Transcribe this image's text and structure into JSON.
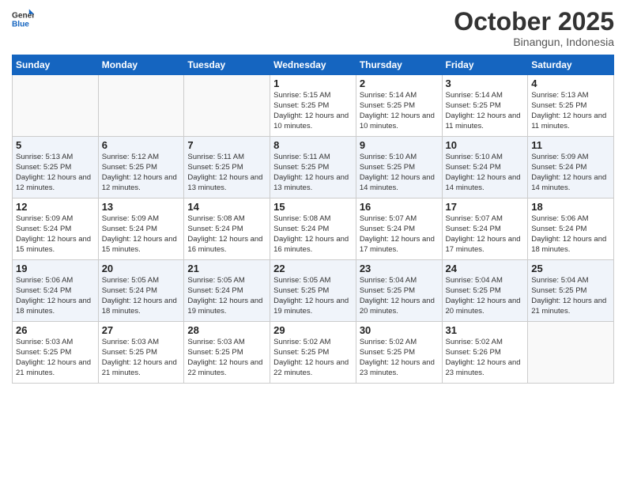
{
  "header": {
    "logo_general": "General",
    "logo_blue": "Blue",
    "month": "October 2025",
    "location": "Binangun, Indonesia"
  },
  "days_of_week": [
    "Sunday",
    "Monday",
    "Tuesday",
    "Wednesday",
    "Thursday",
    "Friday",
    "Saturday"
  ],
  "weeks": [
    [
      {
        "day": "",
        "info": ""
      },
      {
        "day": "",
        "info": ""
      },
      {
        "day": "",
        "info": ""
      },
      {
        "day": "1",
        "info": "Sunrise: 5:15 AM\nSunset: 5:25 PM\nDaylight: 12 hours\nand 10 minutes."
      },
      {
        "day": "2",
        "info": "Sunrise: 5:14 AM\nSunset: 5:25 PM\nDaylight: 12 hours\nand 10 minutes."
      },
      {
        "day": "3",
        "info": "Sunrise: 5:14 AM\nSunset: 5:25 PM\nDaylight: 12 hours\nand 11 minutes."
      },
      {
        "day": "4",
        "info": "Sunrise: 5:13 AM\nSunset: 5:25 PM\nDaylight: 12 hours\nand 11 minutes."
      }
    ],
    [
      {
        "day": "5",
        "info": "Sunrise: 5:13 AM\nSunset: 5:25 PM\nDaylight: 12 hours\nand 12 minutes."
      },
      {
        "day": "6",
        "info": "Sunrise: 5:12 AM\nSunset: 5:25 PM\nDaylight: 12 hours\nand 12 minutes."
      },
      {
        "day": "7",
        "info": "Sunrise: 5:11 AM\nSunset: 5:25 PM\nDaylight: 12 hours\nand 13 minutes."
      },
      {
        "day": "8",
        "info": "Sunrise: 5:11 AM\nSunset: 5:25 PM\nDaylight: 12 hours\nand 13 minutes."
      },
      {
        "day": "9",
        "info": "Sunrise: 5:10 AM\nSunset: 5:25 PM\nDaylight: 12 hours\nand 14 minutes."
      },
      {
        "day": "10",
        "info": "Sunrise: 5:10 AM\nSunset: 5:24 PM\nDaylight: 12 hours\nand 14 minutes."
      },
      {
        "day": "11",
        "info": "Sunrise: 5:09 AM\nSunset: 5:24 PM\nDaylight: 12 hours\nand 14 minutes."
      }
    ],
    [
      {
        "day": "12",
        "info": "Sunrise: 5:09 AM\nSunset: 5:24 PM\nDaylight: 12 hours\nand 15 minutes."
      },
      {
        "day": "13",
        "info": "Sunrise: 5:09 AM\nSunset: 5:24 PM\nDaylight: 12 hours\nand 15 minutes."
      },
      {
        "day": "14",
        "info": "Sunrise: 5:08 AM\nSunset: 5:24 PM\nDaylight: 12 hours\nand 16 minutes."
      },
      {
        "day": "15",
        "info": "Sunrise: 5:08 AM\nSunset: 5:24 PM\nDaylight: 12 hours\nand 16 minutes."
      },
      {
        "day": "16",
        "info": "Sunrise: 5:07 AM\nSunset: 5:24 PM\nDaylight: 12 hours\nand 17 minutes."
      },
      {
        "day": "17",
        "info": "Sunrise: 5:07 AM\nSunset: 5:24 PM\nDaylight: 12 hours\nand 17 minutes."
      },
      {
        "day": "18",
        "info": "Sunrise: 5:06 AM\nSunset: 5:24 PM\nDaylight: 12 hours\nand 18 minutes."
      }
    ],
    [
      {
        "day": "19",
        "info": "Sunrise: 5:06 AM\nSunset: 5:24 PM\nDaylight: 12 hours\nand 18 minutes."
      },
      {
        "day": "20",
        "info": "Sunrise: 5:05 AM\nSunset: 5:24 PM\nDaylight: 12 hours\nand 18 minutes."
      },
      {
        "day": "21",
        "info": "Sunrise: 5:05 AM\nSunset: 5:24 PM\nDaylight: 12 hours\nand 19 minutes."
      },
      {
        "day": "22",
        "info": "Sunrise: 5:05 AM\nSunset: 5:25 PM\nDaylight: 12 hours\nand 19 minutes."
      },
      {
        "day": "23",
        "info": "Sunrise: 5:04 AM\nSunset: 5:25 PM\nDaylight: 12 hours\nand 20 minutes."
      },
      {
        "day": "24",
        "info": "Sunrise: 5:04 AM\nSunset: 5:25 PM\nDaylight: 12 hours\nand 20 minutes."
      },
      {
        "day": "25",
        "info": "Sunrise: 5:04 AM\nSunset: 5:25 PM\nDaylight: 12 hours\nand 21 minutes."
      }
    ],
    [
      {
        "day": "26",
        "info": "Sunrise: 5:03 AM\nSunset: 5:25 PM\nDaylight: 12 hours\nand 21 minutes."
      },
      {
        "day": "27",
        "info": "Sunrise: 5:03 AM\nSunset: 5:25 PM\nDaylight: 12 hours\nand 21 minutes."
      },
      {
        "day": "28",
        "info": "Sunrise: 5:03 AM\nSunset: 5:25 PM\nDaylight: 12 hours\nand 22 minutes."
      },
      {
        "day": "29",
        "info": "Sunrise: 5:02 AM\nSunset: 5:25 PM\nDaylight: 12 hours\nand 22 minutes."
      },
      {
        "day": "30",
        "info": "Sunrise: 5:02 AM\nSunset: 5:25 PM\nDaylight: 12 hours\nand 23 minutes."
      },
      {
        "day": "31",
        "info": "Sunrise: 5:02 AM\nSunset: 5:26 PM\nDaylight: 12 hours\nand 23 minutes."
      },
      {
        "day": "",
        "info": ""
      }
    ]
  ]
}
